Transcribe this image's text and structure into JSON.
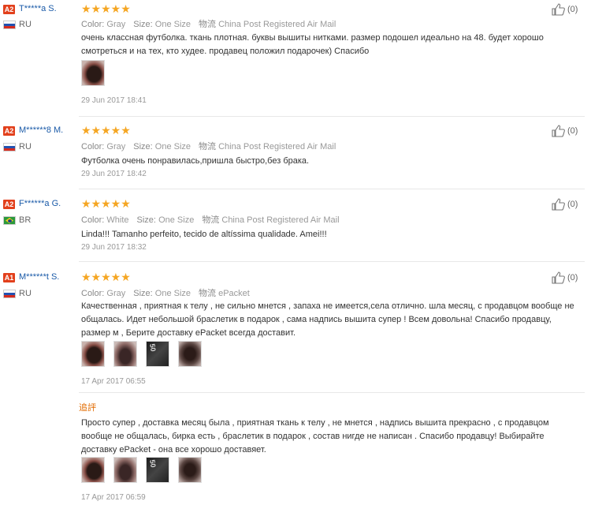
{
  "labels": {
    "color": "Color:",
    "size": "Size:",
    "shipping": "物流",
    "feedback": "追評"
  },
  "reviews": [
    {
      "badge": "A2",
      "user": "T*****a S.",
      "country": "RU",
      "color": "Gray",
      "size": "One Size",
      "shipping": "China Post Registered Air Mail",
      "text": "очень классная футболка. ткань плотная. буквы вышиты нитками. размер подошел идеально на 48. будет хорошо смотреться и на тех, кто худее. продавец положил подарочек) Спасибо",
      "date": "29 Jun 2017 18:41",
      "likes": "(0)"
    },
    {
      "badge": "A2",
      "user": "M******8 M.",
      "country": "RU",
      "color": "Gray",
      "size": "One Size",
      "shipping": "China Post Registered Air Mail",
      "text": "Футболка очень понравилась,пришла быстро,без брака.",
      "date": "29 Jun 2017 18:42",
      "likes": "(0)"
    },
    {
      "badge": "A2",
      "user": "F******a G.",
      "country": "BR",
      "color": "White",
      "size": "One Size",
      "shipping": "China Post Registered Air Mail",
      "text": "Linda!!! Tamanho perfeito, tecido de altíssima qualidade. Amei!!!",
      "date": "29 Jun 2017 18:32",
      "likes": "(0)"
    },
    {
      "badge": "A1",
      "user": "M******t S.",
      "country": "RU",
      "color": "Gray",
      "size": "One Size",
      "shipping": "ePacket",
      "text": "Качественная , приятная к телу , не сильно мнется , запаха не имеется,села отлично. шла месяц, с продавцом вообще не общалась. Идет небольшой браслетик в подарок , сама надпись вышита супер ! Всем довольна! Спасибо продавцу, размер м , Берите доставку ePacket всегда доставит.",
      "date": "17 Apr 2017 06:55",
      "likes": "(0)",
      "followup_text": "Просто супер , доставка месяц была , приятная ткань к телу , не мнется , надпись вышита прекрасно , с продавцом вообще не общалась, бирка есть , браслетик в подарок , состав нигде не написан . Спасибо продавцу! Выбирайте доставку ePacket - она все хорошо доставяет.",
      "followup_date": "17 Apr 2017 06:59"
    }
  ],
  "rating_stars": "★★★★★",
  "thumb_label": "50"
}
